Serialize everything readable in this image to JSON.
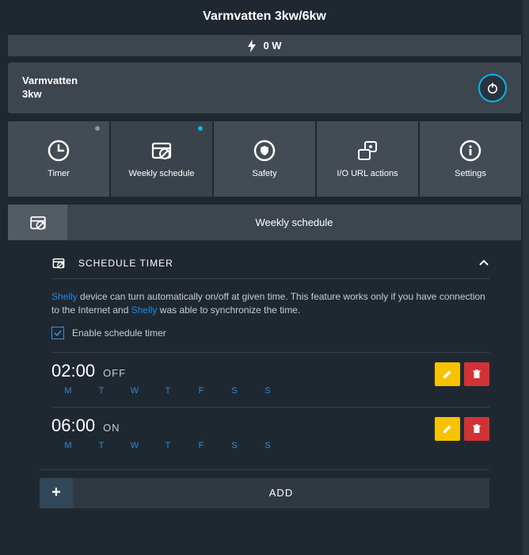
{
  "page_title": "Varmvatten 3kw/6kw",
  "power_bar": {
    "watts": "0 W"
  },
  "device": {
    "name_line1": "Varmvatten",
    "name_line2": "3kw"
  },
  "tabs": [
    {
      "label": "Timer",
      "icon": "clock-icon",
      "dot": "gray"
    },
    {
      "label": "Weekly schedule",
      "icon": "calendar-icon",
      "dot": "blue",
      "active": true
    },
    {
      "label": "Safety",
      "icon": "shield-icon"
    },
    {
      "label": "I/O URL actions",
      "icon": "io-icon"
    },
    {
      "label": "Settings",
      "icon": "info-icon"
    }
  ],
  "section": {
    "label": "Weekly schedule"
  },
  "subsection": {
    "label": "SCHEDULE TIMER",
    "desc_pre": "",
    "link1": "Shelly",
    "desc_mid": " device can turn automatically on/off at given time. This feature works only if you have connection to the Internet and ",
    "link2": "Shelly",
    "desc_post": " was able to synchronize the time."
  },
  "enable_checkbox": {
    "label": "Enable schedule timer",
    "checked": true
  },
  "days": [
    "M",
    "T",
    "W",
    "T",
    "F",
    "S",
    "S"
  ],
  "schedules": [
    {
      "time": "02:00",
      "state": "OFF"
    },
    {
      "time": "06:00",
      "state": "ON"
    }
  ],
  "add_button": {
    "label": "ADD"
  }
}
